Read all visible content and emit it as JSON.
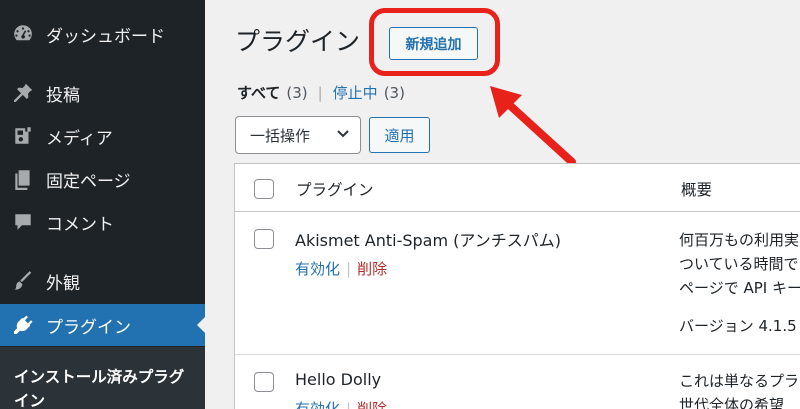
{
  "sidebar": {
    "items": [
      {
        "label": "ダッシュボード",
        "icon": "dashboard-icon"
      },
      {
        "label": "投稿",
        "icon": "pin-icon"
      },
      {
        "label": "メディア",
        "icon": "media-icon"
      },
      {
        "label": "固定ページ",
        "icon": "page-icon"
      },
      {
        "label": "コメント",
        "icon": "comment-icon"
      },
      {
        "label": "外観",
        "icon": "brush-icon"
      },
      {
        "label": "プラグイン",
        "icon": "plugin-icon"
      }
    ],
    "submenu_label": "インストール済みプラグイン"
  },
  "header": {
    "title": "プラグイン",
    "add_new_label": "新規追加"
  },
  "filters": {
    "all_label": "すべて",
    "all_count": "(3)",
    "separator": "|",
    "inactive_label": "停止中",
    "inactive_count": "(3)"
  },
  "bulk": {
    "select_value": "一括操作",
    "apply_label": "適用"
  },
  "table": {
    "columns": [
      "プラグイン",
      "概要"
    ],
    "rows": [
      {
        "name": "Akismet Anti-Spam (アンチスパム)",
        "activate": "有効化",
        "delete": "削除",
        "description": [
          "何百万もの利用実",
          "ついている時間で",
          "ページで API キー",
          "バージョン 4.1.5"
        ]
      },
      {
        "name": "Hello Dolly",
        "activate": "有効化",
        "delete": "削除",
        "description": [
          "これは単なるプラ",
          "世代全体の希望"
        ]
      }
    ]
  },
  "colors": {
    "sidebar_bg": "#1d2327",
    "accent": "#2271b1",
    "highlight": "#e8221b",
    "delete": "#b32d2e"
  }
}
